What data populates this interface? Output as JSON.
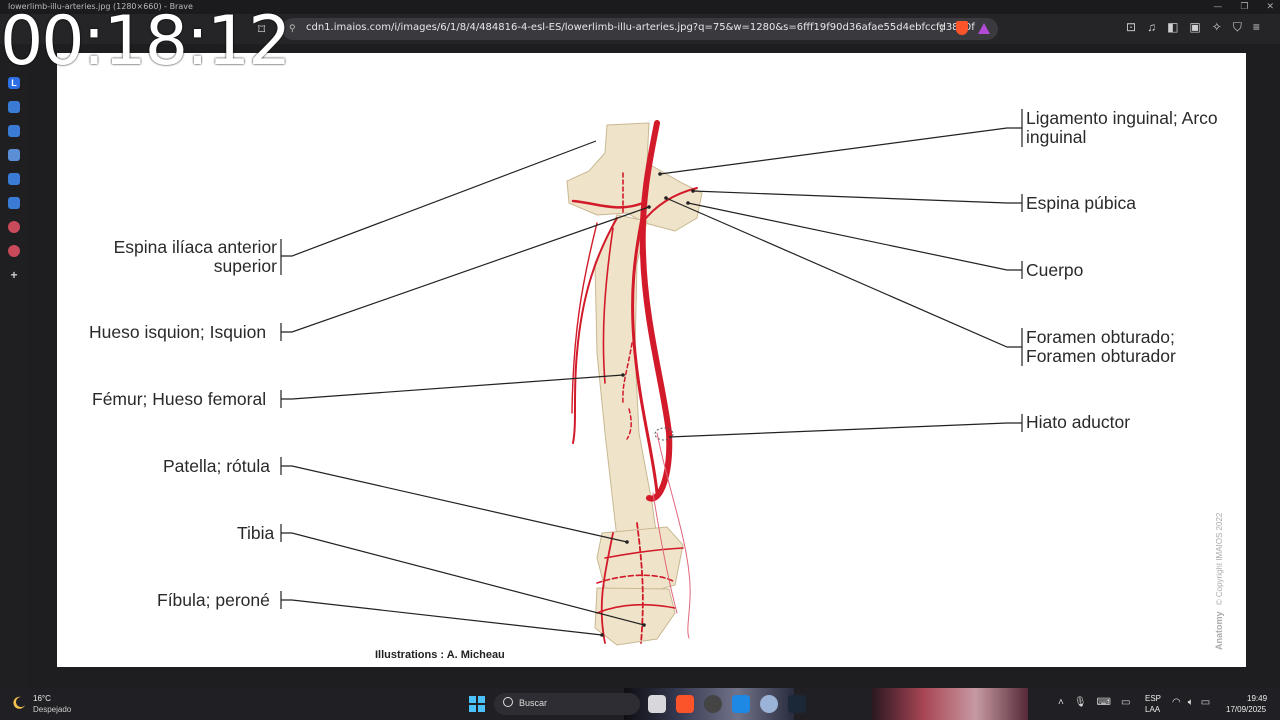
{
  "window": {
    "title": "lowerlimb-illu-arteries.jpg (1280×660) - Brave"
  },
  "browser": {
    "url": "cdn1.imaios.com/i/images/6/1/8/4/484816-4-esl-ES/lowerlimb-illu-arteries.jpg?q=75&w=1280&s=6fff19f90d36afae55d4ebfccfd38d0f"
  },
  "overlay": {
    "timer": "00:18:12"
  },
  "figure": {
    "labels_left": [
      [
        "Espina ilíaca anterior",
        "superior"
      ],
      [
        "Hueso isquion; Isquion"
      ],
      [
        "Fémur; Hueso femoral"
      ],
      [
        "Patella; rótula"
      ],
      [
        "Tibia"
      ],
      [
        "Fíbula; peroné"
      ]
    ],
    "labels_right": [
      [
        "Ligamento inguinal; Arco",
        "inguinal"
      ],
      [
        "Espina púbica"
      ],
      [
        "Cuerpo"
      ],
      [
        "Foramen obturado;",
        "Foramen obturador"
      ],
      [
        "Hiato aductor"
      ]
    ],
    "credit": "Illustrations : A. Micheau",
    "watermark_brand": "Anatomy",
    "watermark_copyright": "© Copyright IMAIOS 2022",
    "colors": {
      "bone": "#efe3c9",
      "bone_outline": "#c9b892",
      "artery": "#d21a2a",
      "leader": "#222222"
    }
  },
  "taskbar": {
    "weather_temp": "16°C",
    "weather_desc": "Despejado",
    "search_label": "Buscar",
    "lang_top": "ESP",
    "lang_bottom": "LAA",
    "time": "19:49",
    "date": "17/09/2025"
  }
}
